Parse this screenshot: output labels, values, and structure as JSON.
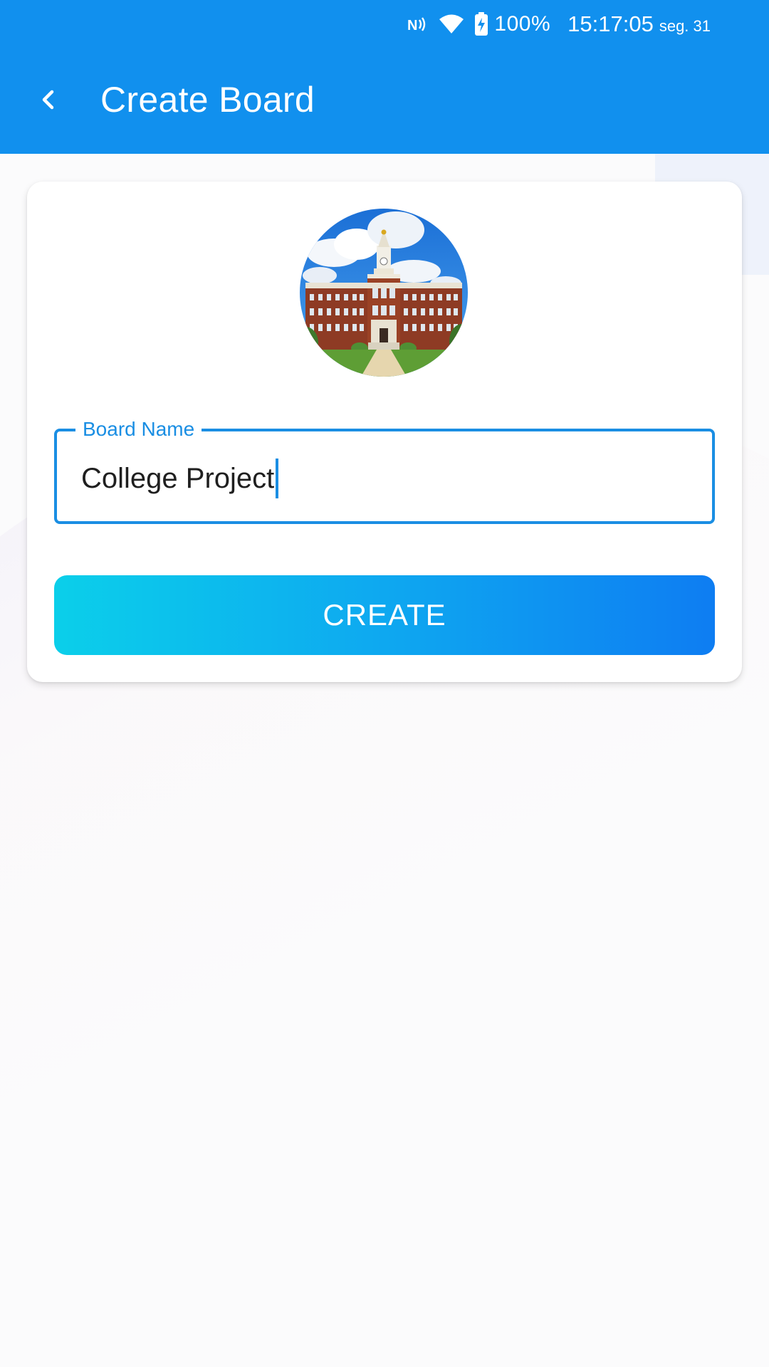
{
  "status_bar": {
    "battery_percent": "100%",
    "time": "15:17:05",
    "day": "seg. 31",
    "icons": [
      "nfc-icon",
      "wifi-icon",
      "battery-charging-icon"
    ]
  },
  "app_bar": {
    "title": "Create Board",
    "back_icon": "chevron-left-icon",
    "background_color": "#1190ee"
  },
  "form": {
    "board_image_alt": "college-building-photo",
    "board_name": {
      "label": "Board Name",
      "value": "College Project"
    },
    "create_button": {
      "label": "CREATE"
    }
  },
  "colors": {
    "accent": "#1a8ee3",
    "button_gradient_start": "#0bcfea",
    "button_gradient_end": "#0e7df2"
  }
}
